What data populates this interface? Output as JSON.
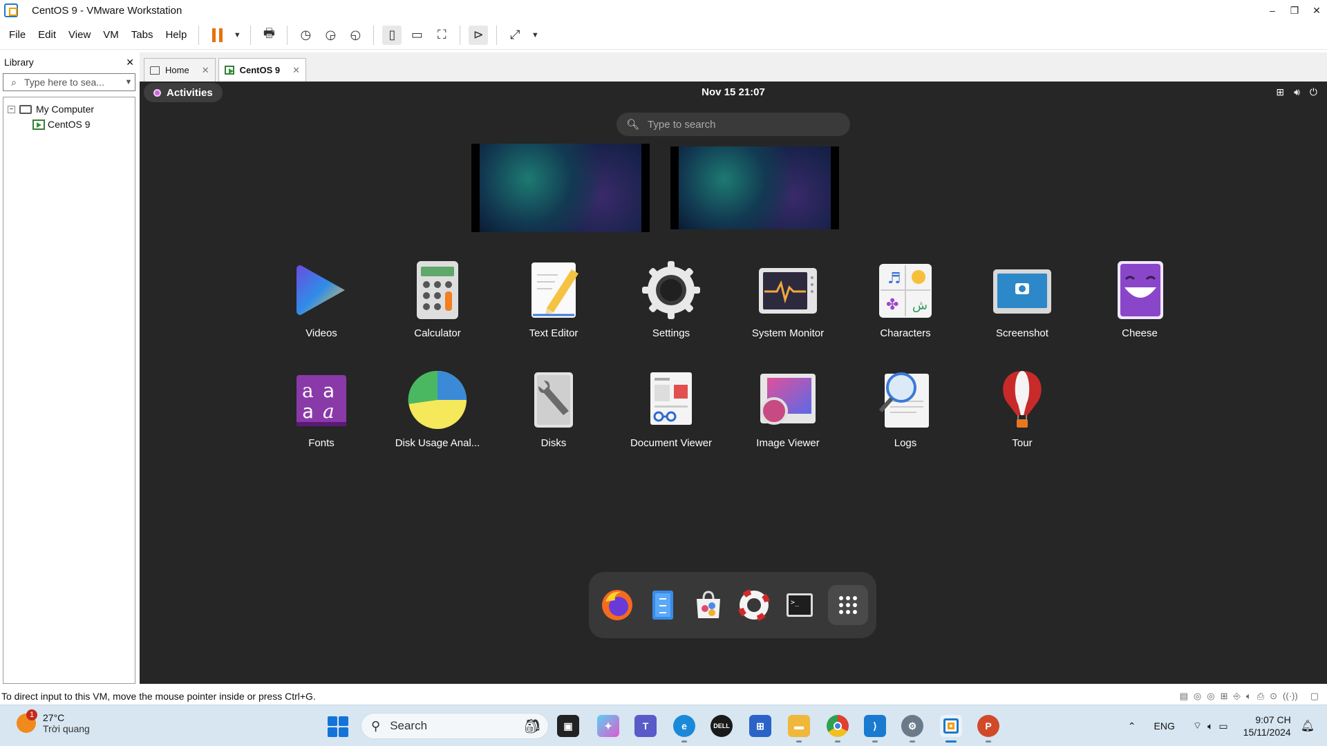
{
  "window": {
    "title": "CentOS 9 - VMware Workstation",
    "minimize": "–",
    "restore": "❐",
    "close": "✕"
  },
  "menus": [
    "File",
    "Edit",
    "View",
    "VM",
    "Tabs",
    "Help"
  ],
  "library": {
    "title": "Library",
    "close": "✕",
    "search_placeholder": "Type here to sea...",
    "tree": {
      "root": "My Computer",
      "expander": "−",
      "child": "CentOS 9"
    }
  },
  "tabs": [
    {
      "label": "Home",
      "close": "✕"
    },
    {
      "label": "CentOS 9",
      "close": "✕"
    }
  ],
  "gnome": {
    "activities": "Activities",
    "clock": "Nov 15  21:07",
    "search_placeholder": "Type to search",
    "apps": [
      {
        "label": "Videos"
      },
      {
        "label": "Calculator"
      },
      {
        "label": "Text Editor"
      },
      {
        "label": "Settings"
      },
      {
        "label": "System Monitor"
      },
      {
        "label": "Characters"
      },
      {
        "label": "Screenshot"
      },
      {
        "label": "Cheese"
      },
      {
        "label": "Fonts"
      },
      {
        "label": "Disk Usage Anal..."
      },
      {
        "label": "Disks"
      },
      {
        "label": "Document Viewer"
      },
      {
        "label": "Image Viewer"
      },
      {
        "label": "Logs"
      },
      {
        "label": "Tour"
      }
    ],
    "dash": [
      "firefox-icon",
      "files-icon",
      "software-icon",
      "help-icon",
      "terminal-icon",
      "app-grid-icon"
    ]
  },
  "statusbar": {
    "text": "To direct input to this VM, move the mouse pointer inside or press Ctrl+G."
  },
  "taskbar": {
    "weather_temp": "27°C",
    "weather_desc": "Trời quang",
    "weather_badge": "1",
    "search": "Search",
    "lang": "ENG",
    "time": "9:07 CH",
    "date": "15/11/2024"
  }
}
